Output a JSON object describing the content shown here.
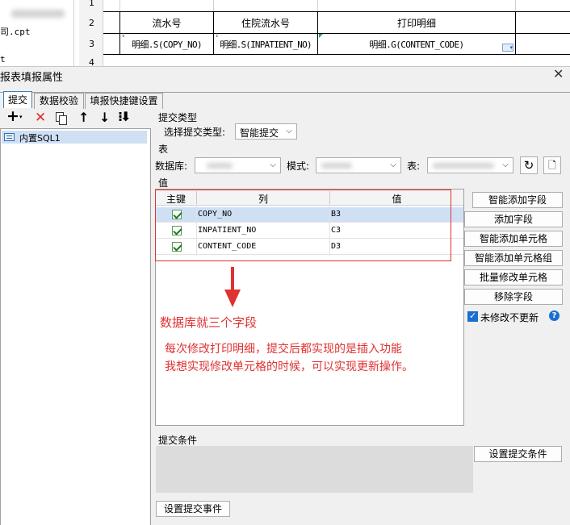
{
  "sheet": {
    "left_rows": [
      "",
      "",
      "",
      "4"
    ],
    "row_numbers": [
      "1",
      "2",
      "3",
      "4"
    ],
    "header_cells": [
      "流水号",
      "住院流水号",
      "打印明细"
    ],
    "data_cells": [
      "明细.S(COPY_NO)",
      "明细.S(INPATIENT_NO)",
      "明细.G(CONTENT_CODE)"
    ],
    "left_fragments": [
      "司.cpt",
      "t"
    ]
  },
  "dialog": {
    "title": "报表填报属性",
    "tabs": [
      "提交",
      "数据校验",
      "填报快捷键设置"
    ],
    "toolbar_icons": [
      "add-icon",
      "delete-icon",
      "copy-icon",
      "move-up-icon",
      "move-down-icon",
      "move-bottom-icon"
    ],
    "tree_item": "内置SQL1",
    "submit_type_section": "提交类型",
    "submit_type_label": "选择提交类型:",
    "submit_type_value": "智能提交",
    "table_section": "表",
    "db_label": "数据库:",
    "mode_label": "模式:",
    "table_label": "表:",
    "value_section": "值",
    "grid_headers": [
      "主键",
      "列",
      "值"
    ],
    "grid_rows": [
      {
        "col": "COPY_NO",
        "val": "B3",
        "checked": true
      },
      {
        "col": "INPATIENT_NO",
        "val": "C3",
        "checked": true
      },
      {
        "col": "CONTENT_CODE",
        "val": "D3",
        "checked": true
      }
    ],
    "side_buttons": [
      "智能添加字段",
      "添加字段",
      "智能添加单元格",
      "智能添加单元格组",
      "批量修改单元格",
      "移除字段"
    ],
    "no_update_label": "未修改不更新",
    "condition_section": "提交条件",
    "set_condition_button": "设置提交条件",
    "set_event_button": "设置提交事件"
  },
  "annotations": {
    "line1": "数据库就三个字段",
    "line2": "每次修改打印明细，提交后都实现的是插入功能",
    "line3": "我想实现修改单元格的时候，可以实现更新操作。"
  },
  "colors": {
    "annotation_red": "#e03131",
    "selected_row": "#cfe0f5",
    "tab_active_border": "#3c7fb1",
    "help_blue": "#1a6fd1"
  }
}
